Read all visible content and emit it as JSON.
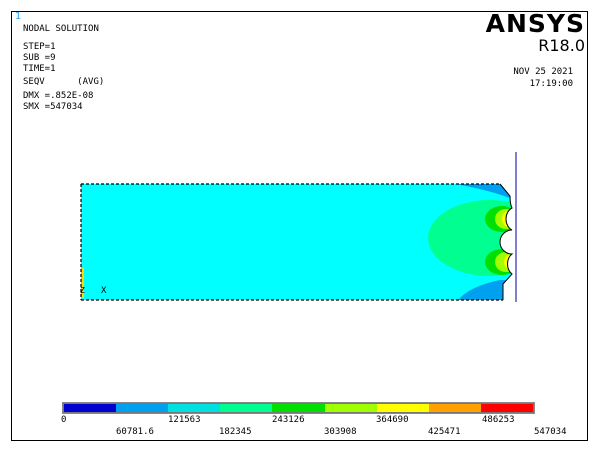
{
  "window_number": "1",
  "info_lines": [
    "NODAL SOLUTION",
    "STEP=1",
    "SUB =9",
    "TIME=1",
    "SEQV      (AVG)",
    "DMX =.852E-08",
    "SMX =547034"
  ],
  "brand": {
    "name": "ANSYS",
    "version": "R18.0"
  },
  "date": "NOV 25 2021",
  "time": "17:19:00",
  "axis_label": {
    "z": "Z",
    "x": "X"
  },
  "legend": {
    "colors": [
      "#0000d0",
      "#00a0f0",
      "#00e0e0",
      "#00ff90",
      "#00e000",
      "#a0ff00",
      "#ffff00",
      "#ffa000",
      "#ff0000"
    ],
    "top_labels": [
      "0",
      "121563",
      "243126",
      "364690",
      "486253"
    ],
    "bottom_labels": [
      "60781.6",
      "182345",
      "303908",
      "425471",
      "547034"
    ]
  },
  "contour_colors": {
    "base": "#00ffff",
    "low": "#00a0f0",
    "mid": "#00ff90",
    "green": "#00e000",
    "lime": "#a0ff00",
    "yellow": "#ffff00",
    "orange": "#ffa000",
    "red": "#ff0000"
  }
}
